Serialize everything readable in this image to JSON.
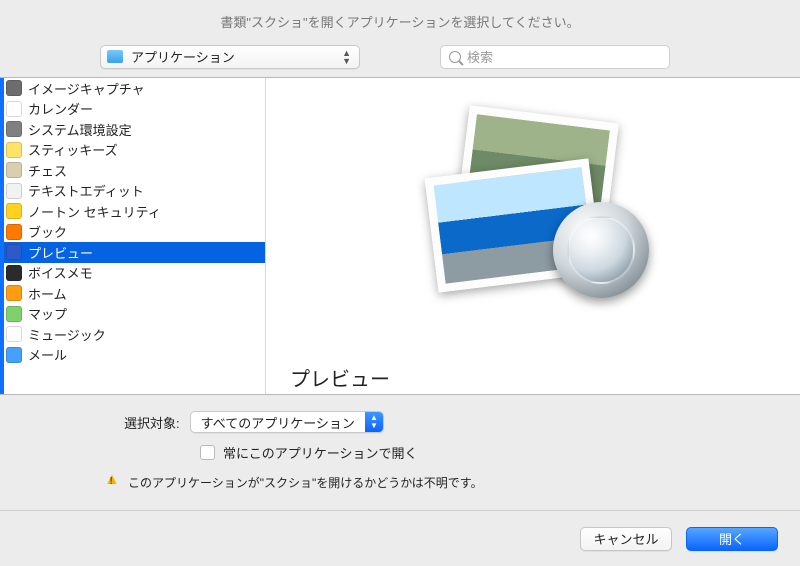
{
  "header": {
    "prompt": "書類\"スクショ\"を開くアプリケーションを選択してください。"
  },
  "toolbar": {
    "path_label": "アプリケーション",
    "search_placeholder": "検索"
  },
  "list": {
    "items": [
      {
        "label": "イメージキャプチャ",
        "icon": "camera-icon",
        "color": "#6d6d6d"
      },
      {
        "label": "カレンダー",
        "icon": "calendar-icon",
        "color": "#ffffff"
      },
      {
        "label": "システム環境設定",
        "icon": "gear-icon",
        "color": "#808080"
      },
      {
        "label": "スティッキーズ",
        "icon": "note-icon",
        "color": "#ffe26a"
      },
      {
        "label": "チェス",
        "icon": "chess-icon",
        "color": "#d9cfae"
      },
      {
        "label": "テキストエディット",
        "icon": "textedit-icon",
        "color": "#f2f2f2"
      },
      {
        "label": "ノートン セキュリティ",
        "icon": "shield-icon",
        "color": "#ffd21f"
      },
      {
        "label": "ブック",
        "icon": "book-icon",
        "color": "#ff7a00"
      },
      {
        "label": "プレビュー",
        "icon": "preview-icon",
        "color": "#2e5ac9",
        "selected": true
      },
      {
        "label": "ボイスメモ",
        "icon": "voice-icon",
        "color": "#2b2b2b"
      },
      {
        "label": "ホーム",
        "icon": "home-icon",
        "color": "#ff9d12"
      },
      {
        "label": "マップ",
        "icon": "map-icon",
        "color": "#7fd26b"
      },
      {
        "label": "ミュージック",
        "icon": "music-icon",
        "color": "#ffffff"
      },
      {
        "label": "メール",
        "icon": "mail-icon",
        "color": "#46a0ff"
      }
    ]
  },
  "preview": {
    "title": "プレビュー"
  },
  "options": {
    "filter_label": "選択対象:",
    "filter_value": "すべてのアプリケーション",
    "always_open_label": "常にこのアプリケーションで開く",
    "warning_text": "このアプリケーションが\"スクショ\"を開けるかどうかは不明です。"
  },
  "footer": {
    "cancel": "キャンセル",
    "open": "開く"
  }
}
